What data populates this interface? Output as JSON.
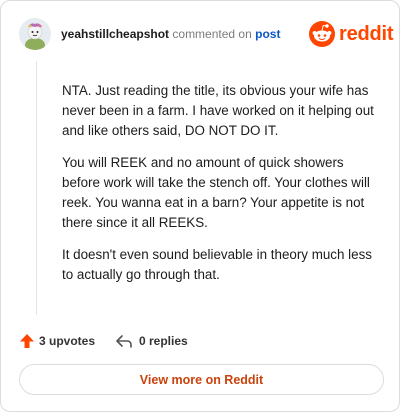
{
  "header": {
    "username": "yeahstillcheapshot",
    "action_text": "commented on",
    "post_link": "post",
    "brand_name": "reddit"
  },
  "comment": {
    "paragraphs": [
      "NTA. Just reading the title, its obvious your wife has never been in a farm. I have worked on it helping out and like others said, DO NOT DO IT.",
      "You will REEK and no amount of quick showers before work will take the stench off. Your clothes will reek. You wanna eat in a barn? Your appetite is not there since it all REEKS.",
      "It doesn't even sound believable in theory much less to actually go through that."
    ]
  },
  "actions": {
    "upvotes_label": "3 upvotes",
    "replies_label": "0 replies"
  },
  "footer": {
    "view_more_label": "View more on Reddit"
  },
  "colors": {
    "brand": "#ff4500",
    "link": "#0a58c4",
    "view_more": "#c8430d"
  },
  "icons": [
    "avatar-icon",
    "reddit-snoo-icon",
    "upvote-arrow-icon",
    "reply-arrow-icon"
  ]
}
